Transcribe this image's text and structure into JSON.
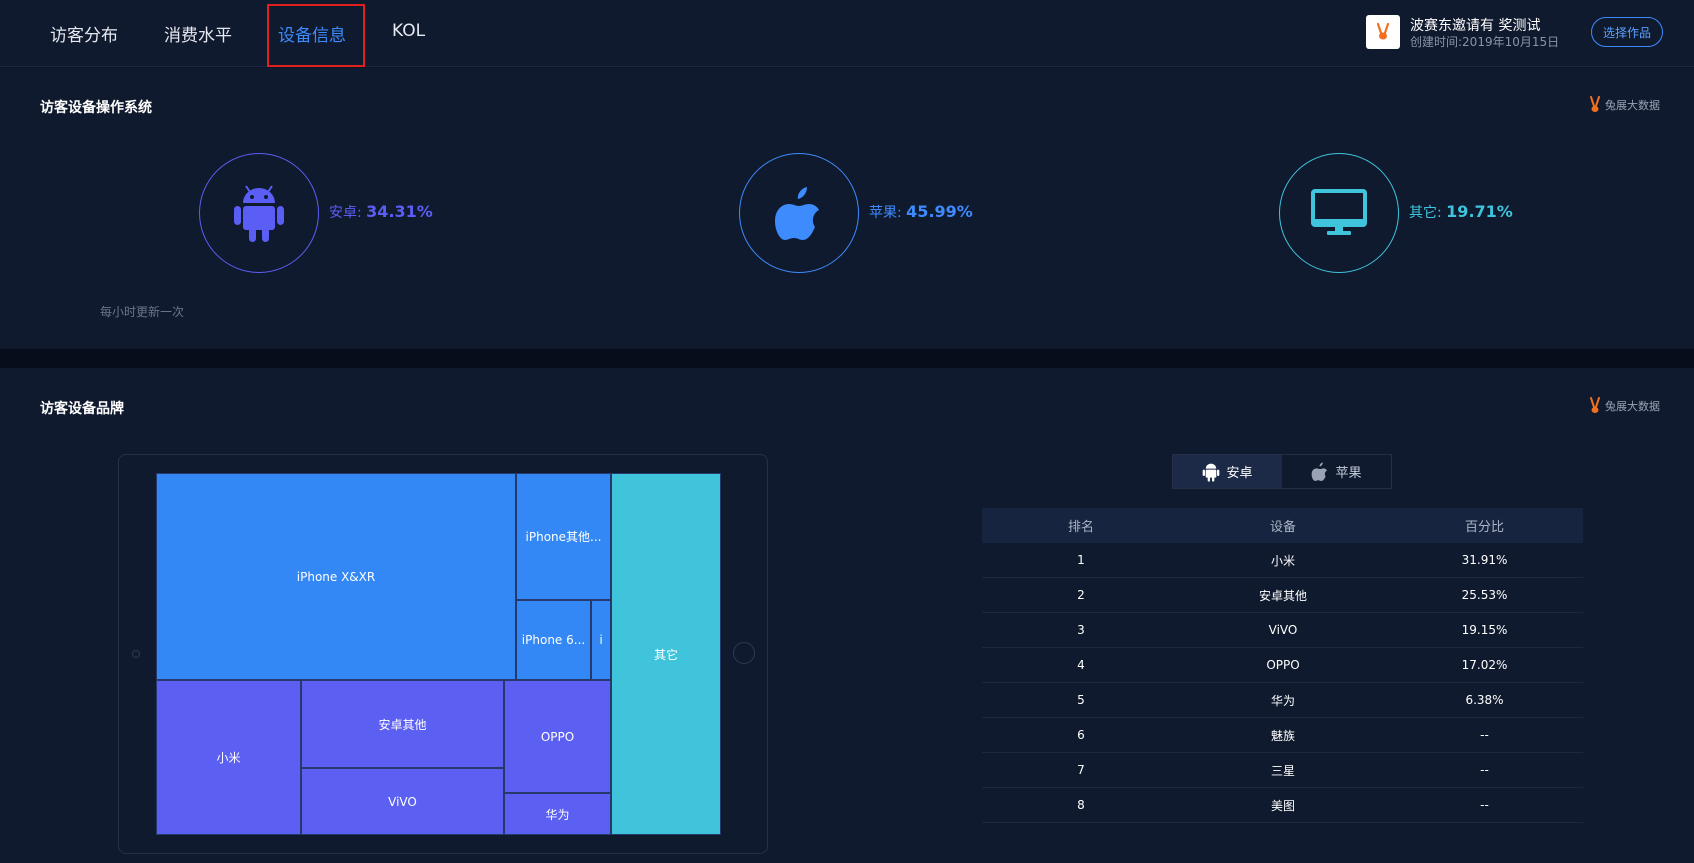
{
  "nav": {
    "tabs": [
      {
        "label": "访客分布"
      },
      {
        "label": "消费水平"
      },
      {
        "label": "设备信息"
      },
      {
        "label": "KOL"
      }
    ],
    "active_index": 2
  },
  "work": {
    "name": "波赛东邀请有 奖测试",
    "created": "创建时间:2019年10月15日",
    "select_label": "选择作品"
  },
  "os_panel": {
    "title": "访客设备操作系统",
    "brand": "兔展大数据",
    "update_note": "每小时更新一次",
    "items": [
      {
        "label": "安卓:",
        "value": "34.31%",
        "color": "#5b5ef5",
        "icon": "android-icon"
      },
      {
        "label": "苹果:",
        "value": "45.99%",
        "color": "#3d8bfd",
        "icon": "apple-icon"
      },
      {
        "label": "其它:",
        "value": "19.71%",
        "color": "#3fc4dc",
        "icon": "monitor-icon"
      }
    ]
  },
  "brand_panel": {
    "title": "访客设备品牌",
    "brand": "兔展大数据",
    "treemap": [
      {
        "label": "iPhone X&XR",
        "group": "apple"
      },
      {
        "label": "iPhone其他...",
        "group": "apple"
      },
      {
        "label": "iPhone 6...",
        "group": "apple"
      },
      {
        "label": "i",
        "group": "apple"
      },
      {
        "label": "小米",
        "group": "android"
      },
      {
        "label": "安卓其他",
        "group": "android"
      },
      {
        "label": "ViVO",
        "group": "android"
      },
      {
        "label": "OPPO",
        "group": "android"
      },
      {
        "label": "华为",
        "group": "android"
      },
      {
        "label": "其它",
        "group": "other"
      }
    ],
    "colors": {
      "apple": "#3388f6",
      "android": "#5b60f2",
      "other": "#3fc4dc"
    },
    "toggle": {
      "android": "安卓",
      "apple": "苹果",
      "selected": "android"
    },
    "table": {
      "headers": [
        "排名",
        "设备",
        "百分比"
      ],
      "rows": [
        [
          "1",
          "小米",
          "31.91%"
        ],
        [
          "2",
          "安卓其他",
          "25.53%"
        ],
        [
          "3",
          "ViVO",
          "19.15%"
        ],
        [
          "4",
          "OPPO",
          "17.02%"
        ],
        [
          "5",
          "华为",
          "6.38%"
        ],
        [
          "6",
          "魅族",
          "--"
        ],
        [
          "7",
          "三星",
          "--"
        ],
        [
          "8",
          "美图",
          "--"
        ]
      ]
    }
  }
}
